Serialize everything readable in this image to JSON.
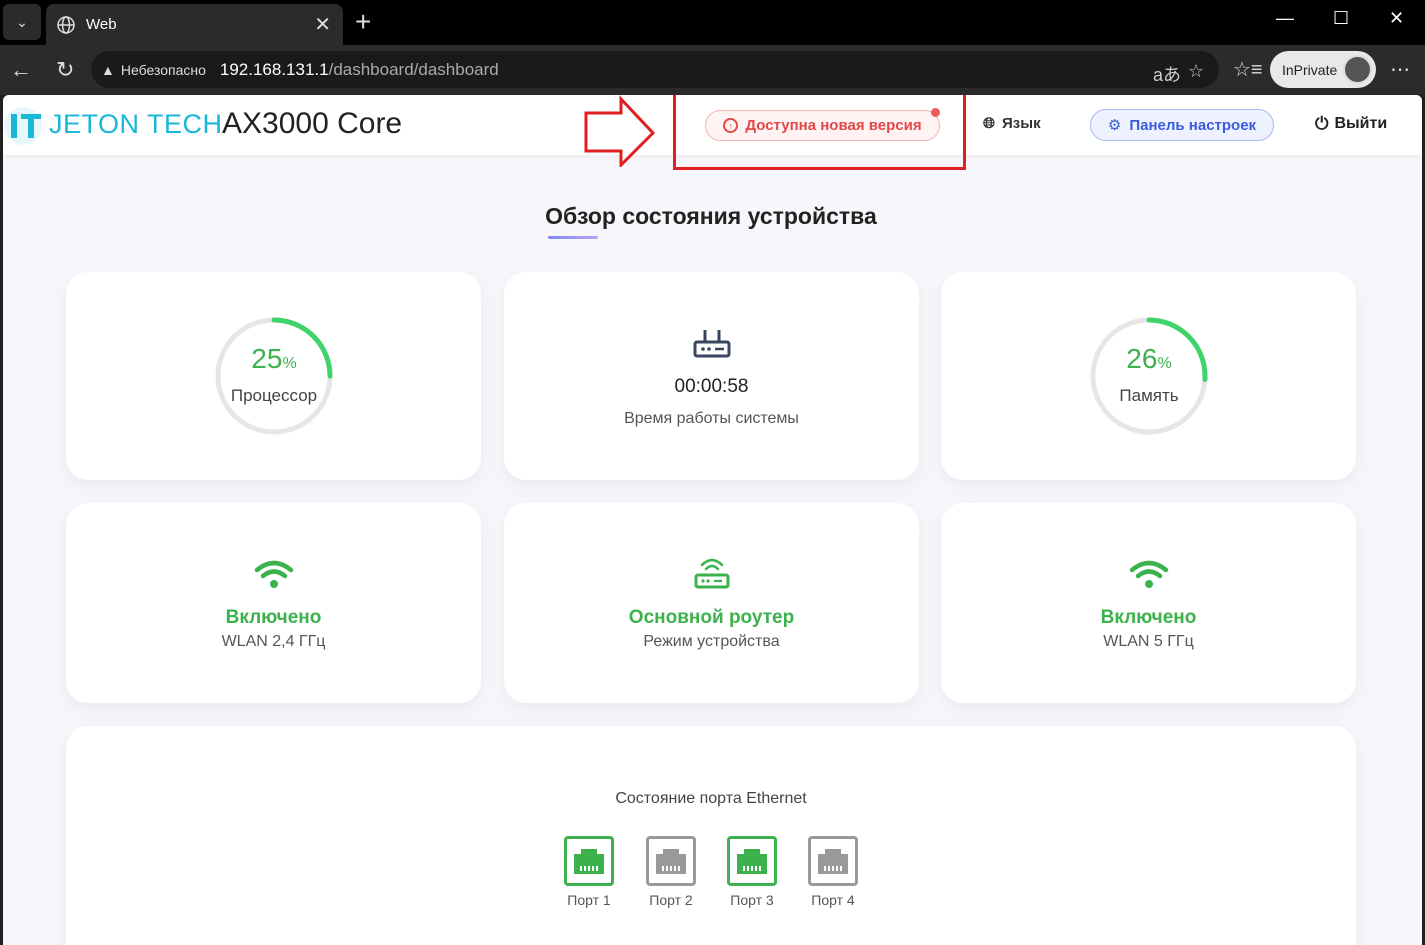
{
  "browser": {
    "tab_title": "Web",
    "url_warning": "Небезопасно",
    "url_host": "192.168.131.1",
    "url_path": "/dashboard/dashboard",
    "inprivate_label": "InPrivate"
  },
  "header": {
    "brand": "JETON TECH",
    "model": "AX3000 Core",
    "update_label": "Доступна новая версия",
    "language_label": "Язык",
    "settings_label": "Панель настроек",
    "logout_label": "Выйти"
  },
  "main": {
    "title": "Обзор состояния устройства",
    "cpu": {
      "value": "25",
      "unit": "%",
      "label": "Процессор",
      "fraction": 0.25
    },
    "uptime": {
      "value": "00:00:58",
      "label": "Время работы системы"
    },
    "memory": {
      "value": "26",
      "unit": "%",
      "label": "Память",
      "fraction": 0.26
    },
    "wlan24": {
      "status": "Включено",
      "label": "WLAN 2,4 ГГц"
    },
    "mode": {
      "status": "Основной роутер",
      "label": "Режим устройства"
    },
    "wlan5": {
      "status": "Включено",
      "label": "WLAN 5 ГГц"
    },
    "ethernet": {
      "title": "Состояние порта Ethernet",
      "ports": [
        {
          "label": "Порт 1",
          "connected": true
        },
        {
          "label": "Порт 2",
          "connected": false
        },
        {
          "label": "Порт 3",
          "connected": true
        },
        {
          "label": "Порт 4",
          "connected": false
        }
      ]
    }
  },
  "colors": {
    "accent_green": "#3bb24c",
    "alert_red": "#e34848",
    "settings_blue": "#3b5bdb",
    "brand_cyan": "#19b8d8",
    "port_off": "#999999"
  }
}
